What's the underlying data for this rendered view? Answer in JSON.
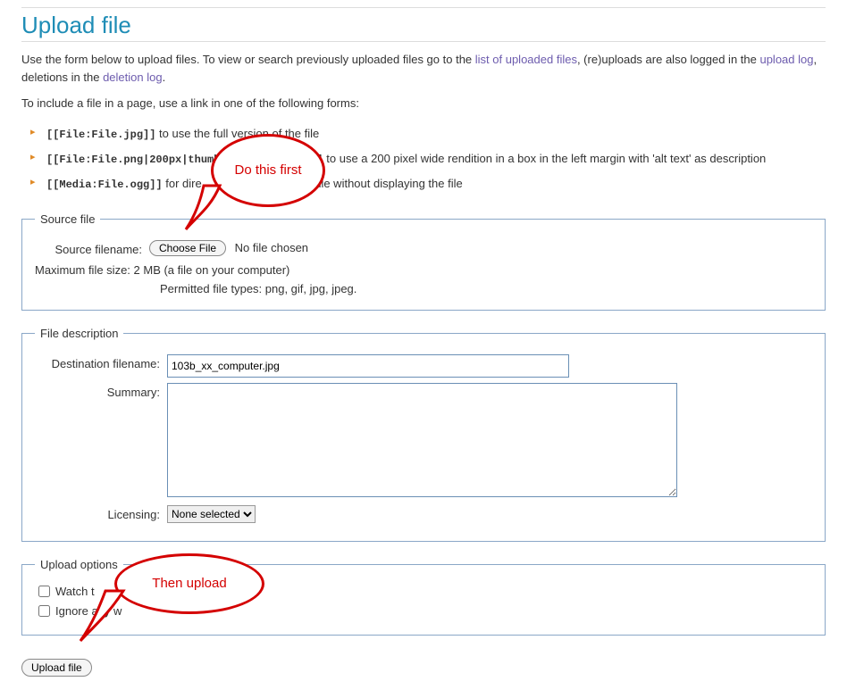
{
  "title": "Upload file",
  "intro_1_pre": "Use the form below to upload files. To view or search previously uploaded files go to the ",
  "intro_link_files": "list of uploaded files",
  "intro_1_post": ", (re)uploads are also logged in the ",
  "intro_link_uploadlog": "upload log",
  "intro_1_post2": ", deletions in the ",
  "intro_link_deletionlog": "deletion log",
  "intro_1_end": ".",
  "include_intro": "To include a file in a page, use a link in one of the following forms:",
  "forms": {
    "item1_code": "[[File:File.jpg]]",
    "item1_desc": " to use the full version of the file",
    "item2_code": "[[File:File.png|200px|thumb|left|alt text]]",
    "item2_desc": " to use a 200 pixel wide rendition in a box in the left margin with 'alt text' as description",
    "item3_code": "[[Media:File.ogg]]",
    "item3_desc_a": " for dire",
    "item3_desc_b": "file without displaying the file"
  },
  "source": {
    "legend": "Source file",
    "filename_label": "Source filename:",
    "choose_btn": "Choose File",
    "no_file": "No file chosen",
    "maxsize": "Maximum file size: 2 MB (a file on your computer)",
    "permitted": "Permitted file types: png, gif, jpg, jpeg."
  },
  "desc": {
    "legend": "File description",
    "dest_label": "Destination filename:",
    "dest_value": "103b_xx_computer.jpg",
    "summary_label": "Summary:",
    "summary_value": "",
    "licensing_label": "Licensing:",
    "licensing_selected": "None selected"
  },
  "options": {
    "legend": "Upload options",
    "watch_label_a": "Watch t",
    "ignore_label_a": "Ignore any w"
  },
  "upload_button": "Upload file",
  "callouts": {
    "first": "Do this first",
    "then": "Then upload"
  }
}
